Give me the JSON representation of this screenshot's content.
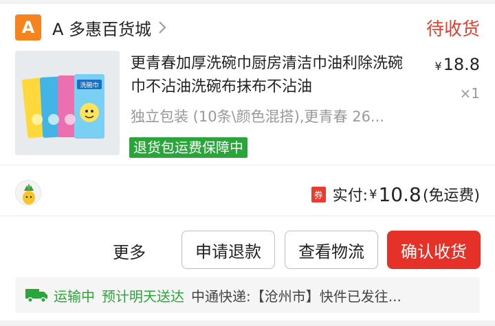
{
  "shop": {
    "logo_letter": "A",
    "name": "A 多惠百货城",
    "status": "待收货",
    "logo_color": "#f5841f"
  },
  "product": {
    "title": "更青春加厚洗碗巾厨房清洁巾油利除洗碗巾不沾油洗碗布抹布不沾油",
    "price_symbol": "¥",
    "price": "18.8",
    "quantity": "×1",
    "spec": "独立包装 (10条\\颜色混搭),更青春 26...",
    "badge": "退货包运费保障中",
    "thumb_icon": "dishcloth-package-image",
    "package_label": "洗碗巾"
  },
  "payment": {
    "coupon_tag": "券",
    "label": "实付:",
    "currency": "¥",
    "amount": "10.8",
    "note": "(免运费)"
  },
  "actions": {
    "more": "更多",
    "refund": "申请退款",
    "logistics": "查看物流",
    "confirm": "确认收货"
  },
  "shipping": {
    "icon": "truck-icon",
    "status": "运输中",
    "eta": "预计明天送达",
    "detail": "中通快递:【沧州市】快件已发往..."
  },
  "colors": {
    "accent_red": "#e63128",
    "status_red": "#e53e30",
    "green": "#2aa53a"
  }
}
